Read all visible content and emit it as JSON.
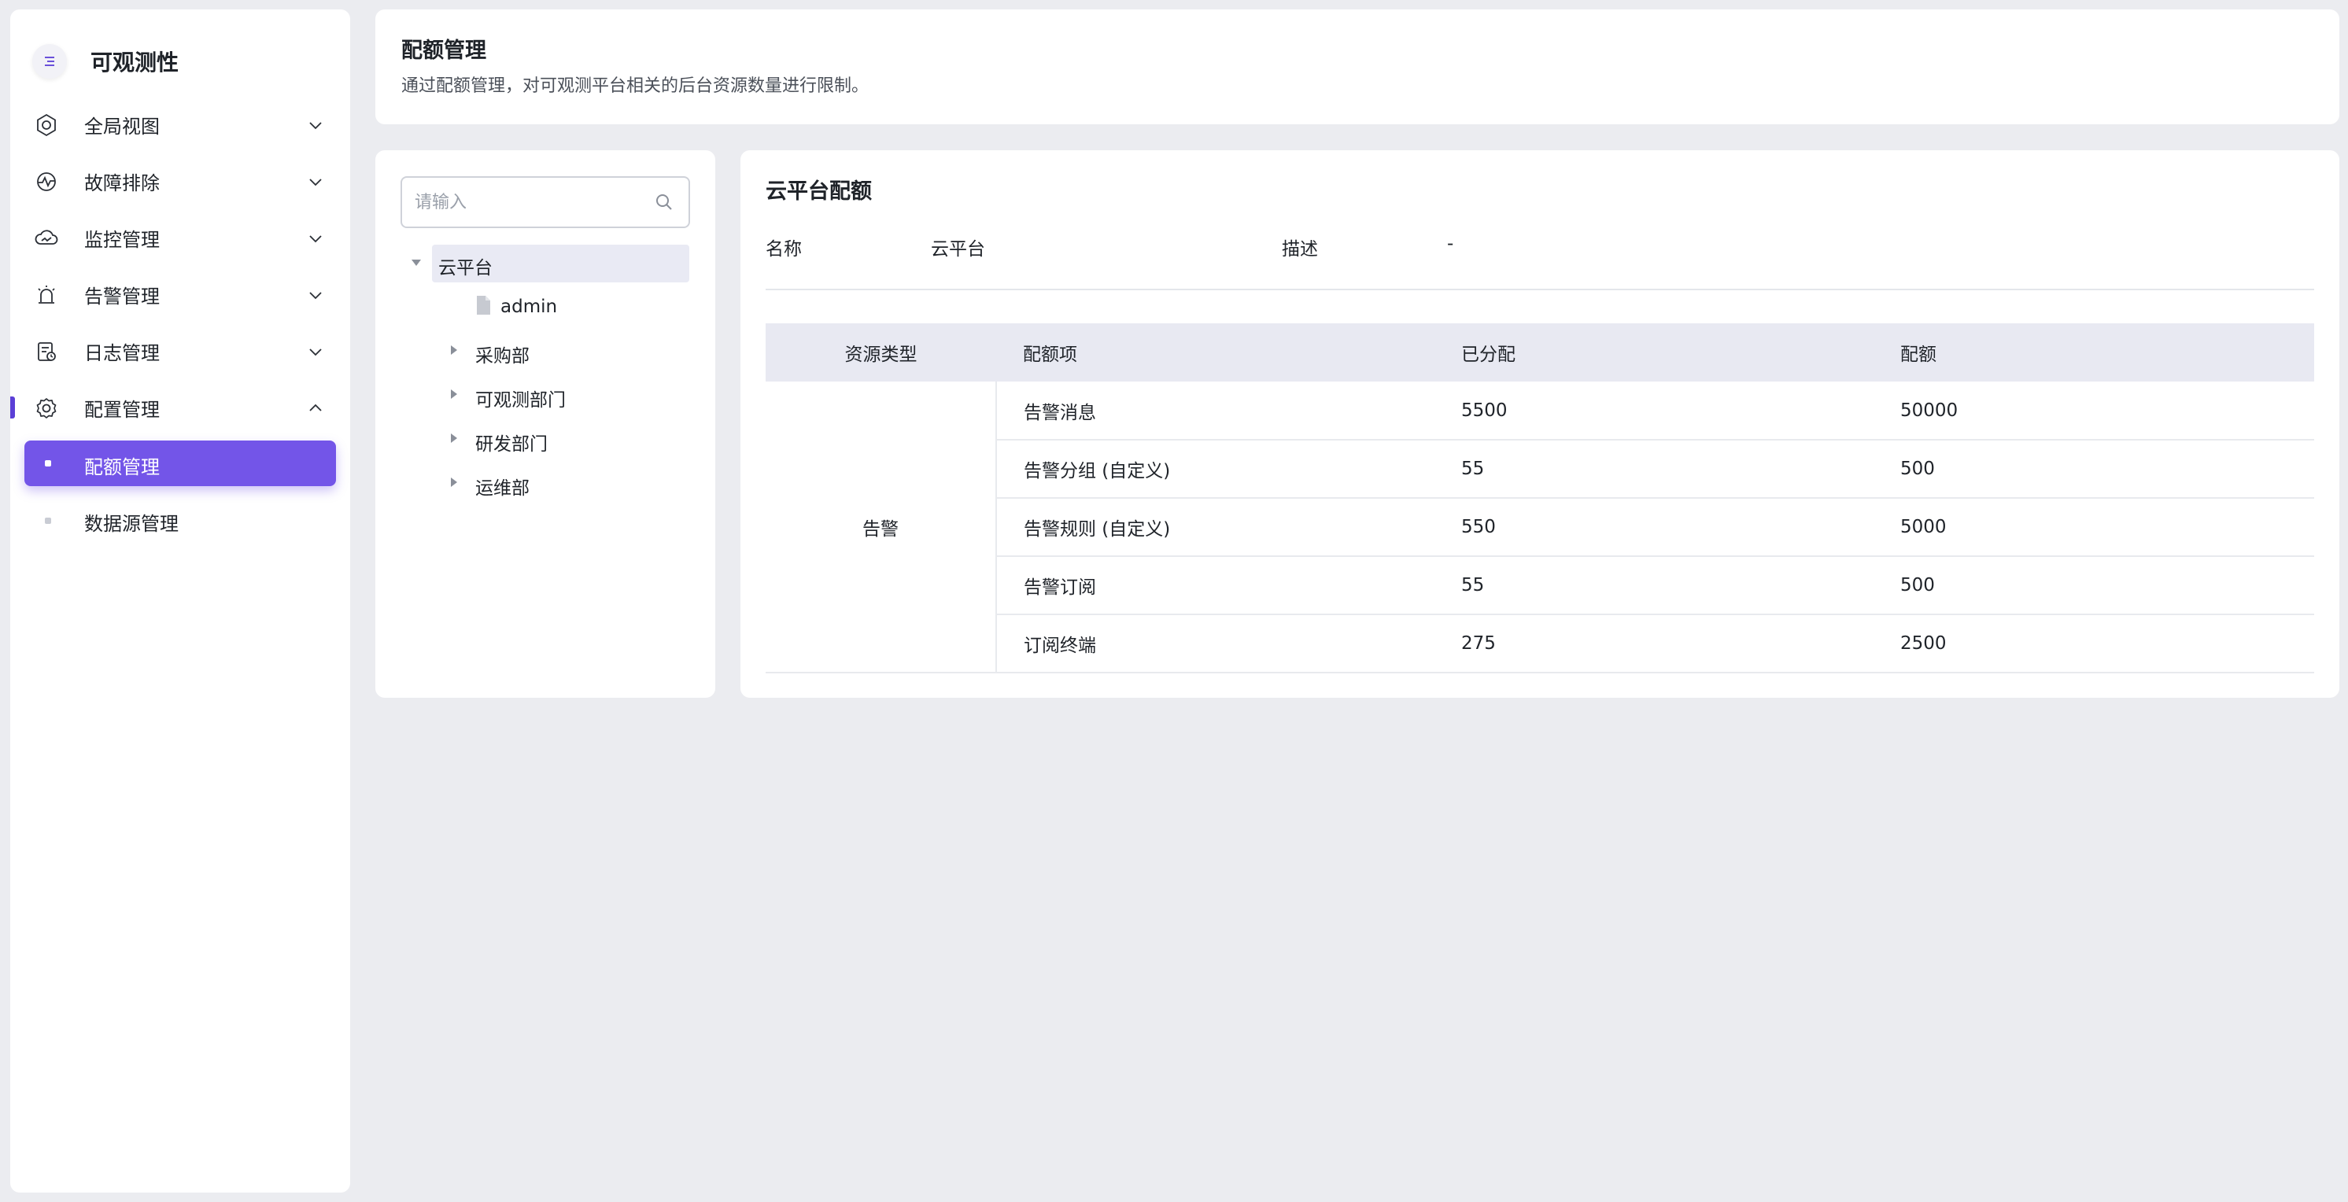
{
  "sidebar": {
    "title": "可观测性",
    "items": [
      {
        "label": "全局视图",
        "icon": "global-view-icon"
      },
      {
        "label": "故障排除",
        "icon": "troubleshoot-icon"
      },
      {
        "label": "监控管理",
        "icon": "monitor-icon"
      },
      {
        "label": "告警管理",
        "icon": "alarm-icon"
      },
      {
        "label": "日志管理",
        "icon": "log-icon"
      },
      {
        "label": "配置管理",
        "icon": "settings-icon",
        "expanded": true
      }
    ],
    "sub_items": [
      {
        "label": "配额管理",
        "active": true
      },
      {
        "label": "数据源管理",
        "active": false
      }
    ],
    "accent_color": "#7355e8"
  },
  "header": {
    "title": "配额管理",
    "description": "通过配额管理，对可观测平台相关的后台资源数量进行限制。"
  },
  "tree": {
    "search_placeholder": "请输入",
    "root": {
      "label": "云平台",
      "expanded": true,
      "selected": true
    },
    "children": [
      {
        "label": "admin",
        "type": "leaf"
      },
      {
        "label": "采购部",
        "type": "collapsed"
      },
      {
        "label": "可观测部门",
        "type": "collapsed"
      },
      {
        "label": "研发部门",
        "type": "collapsed"
      },
      {
        "label": "运维部",
        "type": "collapsed"
      }
    ]
  },
  "detail": {
    "title": "云平台配额",
    "name_label": "名称",
    "name_value": "云平台",
    "desc_label": "描述",
    "desc_value": "-",
    "table": {
      "headers": [
        "资源类型",
        "配额项",
        "已分配",
        "配额"
      ],
      "resource_type": "告警",
      "rows": [
        {
          "item": "告警消息",
          "allocated": "5500",
          "quota": "50000"
        },
        {
          "item": "告警分组 (自定义)",
          "allocated": "55",
          "quota": "500"
        },
        {
          "item": "告警规则 (自定义)",
          "allocated": "550",
          "quota": "5000"
        },
        {
          "item": "告警订阅",
          "allocated": "55",
          "quota": "500"
        },
        {
          "item": "订阅终端",
          "allocated": "275",
          "quota": "2500"
        }
      ]
    }
  }
}
